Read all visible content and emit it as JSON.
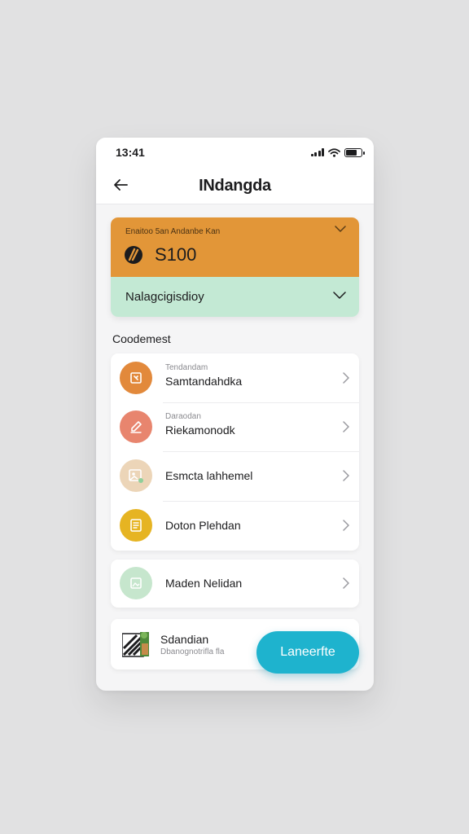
{
  "status_bar": {
    "time": "13:41"
  },
  "header": {
    "title": "INdangda"
  },
  "balance": {
    "caption": "Enaitoo 5an Andanbe Kan",
    "amount": "S100",
    "selector_label": "Nalagcigisdioy",
    "colors": {
      "top": "#e29638",
      "bottom": "#c3e9d4"
    }
  },
  "section": {
    "heading": "Coodemest"
  },
  "list": {
    "items": [
      {
        "subtitle": "Tendandam",
        "title": "Samtandahdka",
        "icon": "receipt-icon",
        "color": "#e2893b"
      },
      {
        "subtitle": "Daraodan",
        "title": "Riekamonodk",
        "icon": "pencil-icon",
        "color": "#e8856e"
      },
      {
        "subtitle": "",
        "title": "Esmcta lahhemel",
        "icon": "image-icon",
        "color": "#ecd5b8"
      },
      {
        "subtitle": "",
        "title": "Doton Plehdan",
        "icon": "document-icon",
        "color": "#e6b422"
      }
    ]
  },
  "single_item": {
    "title": "Maden Nelidan",
    "icon": "photo-icon",
    "color": "#c6e6cd"
  },
  "bottom_card": {
    "title": "Sdandian",
    "subtitle": "Dbanognotrifla fla",
    "thumb": "thumbnail-image"
  },
  "cta": {
    "label": "Laneerfte",
    "color": "#1eb3ce"
  }
}
